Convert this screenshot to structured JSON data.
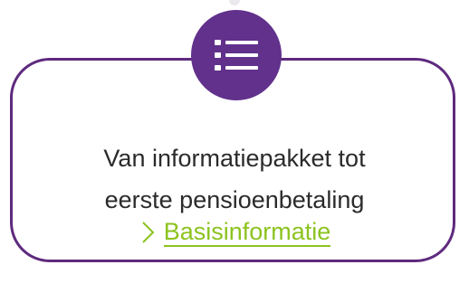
{
  "card": {
    "line1": "Van informatiepakket tot",
    "line2": "eerste pensioenbetaling",
    "link_label": "Basisinformatie",
    "icon": "list-icon",
    "link_icon": "chevron-right-icon"
  },
  "colors": {
    "border": "#5e2a7e",
    "icon_bg": "#61318c",
    "link": "#8cc31f",
    "text": "#2b2b2b"
  }
}
